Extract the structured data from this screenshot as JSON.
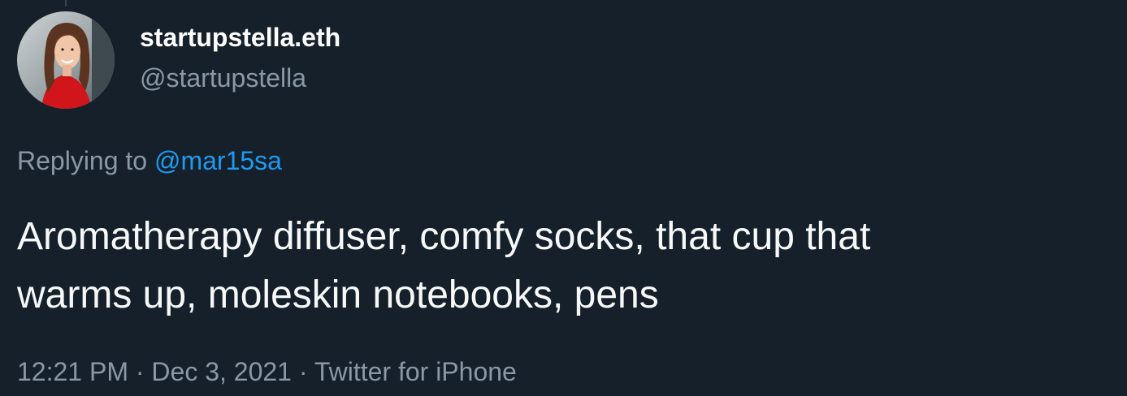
{
  "author": {
    "display_name": "startupstella.eth",
    "handle": "@startupstella",
    "avatar_icon": "profile-photo"
  },
  "reply": {
    "prefix": "Replying to",
    "mention": "@mar15sa"
  },
  "tweet": {
    "lines": [
      "Aromatherapy diffuser, comfy socks, that cup that",
      "warms up, moleskin notebooks, pens"
    ]
  },
  "meta": {
    "time": "12:21 PM",
    "separator": "·",
    "date": "Dec 3, 2021",
    "source": "Twitter for iPhone"
  },
  "colors": {
    "background": "#15202b",
    "primary_text": "#f7f9f9",
    "secondary_text": "#8b98a5",
    "link": "#1d9bf0"
  }
}
